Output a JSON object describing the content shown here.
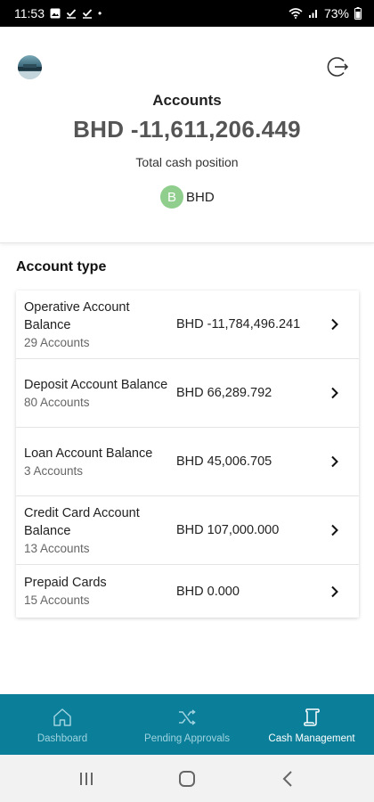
{
  "status_bar": {
    "time": "11:53",
    "battery": "73%",
    "left_icons": [
      "image-icon",
      "check-icon",
      "check-icon",
      "dot-icon"
    ],
    "right_icons": [
      "wifi-icon",
      "signal-icon",
      "battery-icon"
    ]
  },
  "header": {
    "title": "Accounts",
    "avatar_icon": "profile-avatar",
    "logout_icon": "logout-icon"
  },
  "summary": {
    "total_amount": "BHD -11,611,206.449",
    "total_label": "Total cash position",
    "currency_badge": "B",
    "currency_code": "BHD",
    "badge_color": "#8fce8c"
  },
  "accounts": {
    "section_title": "Account type",
    "rows": [
      {
        "name": "Operative Account Balance",
        "count": "29 Accounts",
        "balance": "BHD -11,784,496.241"
      },
      {
        "name": "Deposit Account Balance",
        "count": "80 Accounts",
        "balance": "BHD 66,289.792"
      },
      {
        "name": "Loan Account Balance",
        "count": "3 Accounts",
        "balance": "BHD 45,006.705"
      },
      {
        "name": "Credit Card Account Balance",
        "count": "13 Accounts",
        "balance": "BHD 107,000.000"
      },
      {
        "name": "Prepaid Cards",
        "count": "15 Accounts",
        "balance": "BHD 0.000"
      }
    ]
  },
  "bottom_nav": {
    "accent_color": "#0b7f99",
    "items": [
      {
        "label": "Dashboard",
        "icon": "home-icon",
        "active": false
      },
      {
        "label": "Pending Approvals",
        "icon": "shuffle-icon",
        "active": false
      },
      {
        "label": "Cash Management",
        "icon": "scroll-icon",
        "active": true
      }
    ]
  },
  "system_nav": {
    "buttons": [
      "recents-icon",
      "home-icon",
      "back-icon"
    ]
  }
}
